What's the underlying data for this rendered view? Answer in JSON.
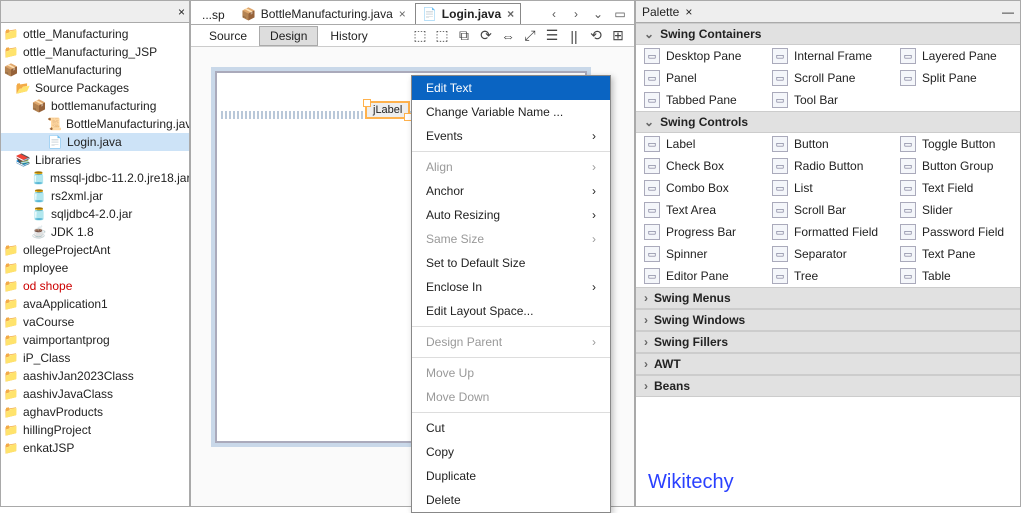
{
  "left": {
    "close": "×",
    "nodes": [
      {
        "icon": "📁",
        "label": "ottle_Manufacturing",
        "indent": 0
      },
      {
        "icon": "📁",
        "label": "ottle_Manufacturing_JSP",
        "indent": 0
      },
      {
        "icon": "📦",
        "label": "ottleManufacturing",
        "indent": 0
      },
      {
        "icon": "📂",
        "label": "Source Packages",
        "indent": 1
      },
      {
        "icon": "📦",
        "label": "bottlemanufacturing",
        "indent": 2
      },
      {
        "icon": "📜",
        "label": "BottleManufacturing.jav",
        "indent": 3
      },
      {
        "icon": "📄",
        "label": "Login.java",
        "indent": 3,
        "selected": true
      },
      {
        "icon": "📚",
        "label": "Libraries",
        "indent": 1
      },
      {
        "icon": "🫙",
        "label": "mssql-jdbc-11.2.0.jre18.jar",
        "indent": 2
      },
      {
        "icon": "🫙",
        "label": "rs2xml.jar",
        "indent": 2
      },
      {
        "icon": "🫙",
        "label": "sqljdbc4-2.0.jar",
        "indent": 2
      },
      {
        "icon": "☕",
        "label": "JDK 1.8",
        "indent": 2
      },
      {
        "icon": "📁",
        "label": "ollegeProjectAnt",
        "indent": 0
      },
      {
        "icon": "📁",
        "label": "mployee",
        "indent": 0
      },
      {
        "icon": "📁",
        "label": "od shope",
        "indent": 0,
        "red": true
      },
      {
        "icon": "📁",
        "label": "avaApplication1",
        "indent": 0
      },
      {
        "icon": "📁",
        "label": "vaCourse",
        "indent": 0
      },
      {
        "icon": "📁",
        "label": "vaimportantprog",
        "indent": 0
      },
      {
        "icon": "📁",
        "label": "iP_Class",
        "indent": 0
      },
      {
        "icon": "📁",
        "label": "aashivJan2023Class",
        "indent": 0
      },
      {
        "icon": "📁",
        "label": "aashivJavaClass",
        "indent": 0
      },
      {
        "icon": "📁",
        "label": "aghavProducts",
        "indent": 0
      },
      {
        "icon": "📁",
        "label": "hillingProject",
        "indent": 0
      },
      {
        "icon": "📁",
        "label": "enkatJSP",
        "indent": 0
      }
    ]
  },
  "center": {
    "editorTabs": [
      {
        "icon": "",
        "label": "...sp",
        "active": false,
        "closable": false
      },
      {
        "icon": "📦",
        "label": "BottleManufacturing.java",
        "active": false,
        "closable": true
      },
      {
        "icon": "📄",
        "label": "Login.java",
        "active": true,
        "closable": true
      }
    ],
    "navIcons": [
      "‹",
      "›",
      "⌄",
      "▭"
    ],
    "subTabs": [
      {
        "label": "Source",
        "active": false
      },
      {
        "label": "Design",
        "active": true
      },
      {
        "label": "History",
        "active": false
      }
    ],
    "toolbarIcons": [
      "⬚",
      "⬚",
      "⧉",
      "⟳",
      "⇔",
      "⤢",
      "☰",
      "||",
      "⟲",
      "⊞"
    ],
    "componentLabel": "jLabel",
    "ctx": [
      {
        "label": "Edit Text",
        "hl": true
      },
      {
        "label": "Change Variable Name ..."
      },
      {
        "label": "Events",
        "sub": true
      },
      {
        "sep": true
      },
      {
        "label": "Align",
        "sub": true,
        "disabled": true
      },
      {
        "label": "Anchor",
        "sub": true
      },
      {
        "label": "Auto Resizing",
        "sub": true
      },
      {
        "label": "Same Size",
        "sub": true,
        "disabled": true
      },
      {
        "label": "Set to Default Size"
      },
      {
        "label": "Enclose In",
        "sub": true
      },
      {
        "label": "Edit Layout Space..."
      },
      {
        "sep": true
      },
      {
        "label": "Design Parent",
        "sub": true,
        "disabled": true
      },
      {
        "sep": true
      },
      {
        "label": "Move Up",
        "disabled": true
      },
      {
        "label": "Move Down",
        "disabled": true
      },
      {
        "sep": true
      },
      {
        "label": "Cut"
      },
      {
        "label": "Copy"
      },
      {
        "label": "Duplicate"
      },
      {
        "label": "Delete"
      }
    ]
  },
  "right": {
    "title": "Palette",
    "close": "×",
    "min": "—",
    "categories": [
      {
        "name": "Swing Containers",
        "open": true,
        "items": [
          "Desktop Pane",
          "Internal Frame",
          "Layered Pane",
          "Panel",
          "Scroll Pane",
          "Split Pane",
          "Tabbed Pane",
          "Tool Bar"
        ]
      },
      {
        "name": "Swing Controls",
        "open": true,
        "items": [
          "Label",
          "Button",
          "Toggle Button",
          "Check Box",
          "Radio Button",
          "Button Group",
          "Combo Box",
          "List",
          "Text Field",
          "Text Area",
          "Scroll Bar",
          "Slider",
          "Progress Bar",
          "Formatted Field",
          "Password Field",
          "Spinner",
          "Separator",
          "Text Pane",
          "Editor Pane",
          "Tree",
          "Table"
        ]
      },
      {
        "name": "Swing Menus",
        "open": false
      },
      {
        "name": "Swing Windows",
        "open": false
      },
      {
        "name": "Swing Fillers",
        "open": false
      },
      {
        "name": "AWT",
        "open": false
      },
      {
        "name": "Beans",
        "open": false
      }
    ],
    "watermark": "Wikitechy"
  }
}
